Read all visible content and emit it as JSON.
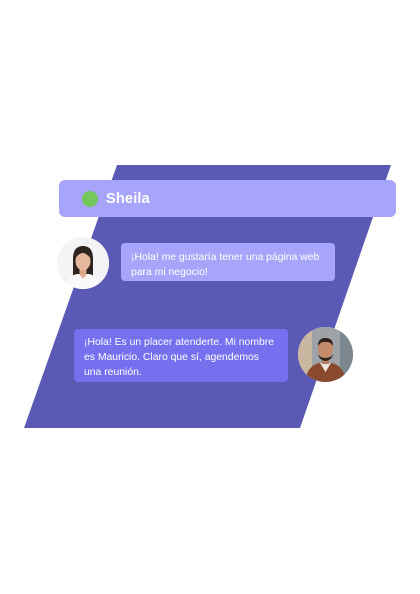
{
  "chat": {
    "contact": {
      "name": "Sheila",
      "status": "online"
    },
    "messages": [
      {
        "sender": "Sheila",
        "text": "¡Hola! me gustaría tener una página web para mi negocio!"
      },
      {
        "sender": "Mauricio",
        "text": "¡Hola! Es un placer atenderte. Mi nombre es Mauricio. Claro que sí, agendemos una reunión."
      }
    ]
  },
  "colors": {
    "backdrop": "#5a5ab5",
    "header": "#a7a4fb",
    "status_online": "#74c85a",
    "incoming_bubble": "#a7a4fb",
    "outgoing_bubble": "#7470ee"
  },
  "icons": {
    "status": "online-status-dot",
    "sheila_avatar": "woman-avatar",
    "mauricio_avatar": "man-avatar"
  }
}
